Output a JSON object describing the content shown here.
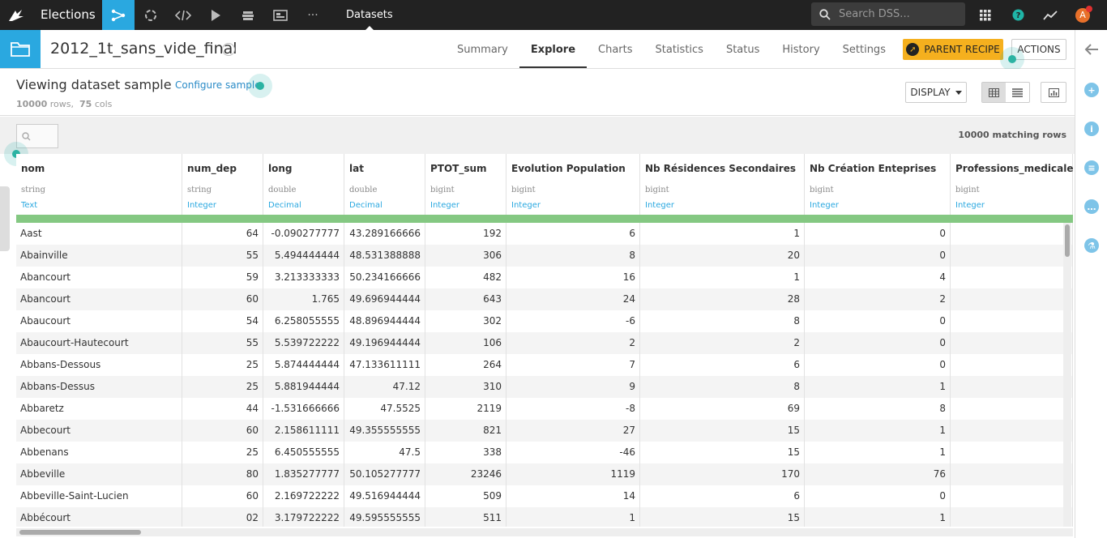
{
  "topbar": {
    "app_title": "Elections",
    "nav_datasets": "Datasets",
    "search_placeholder": "Search DSS...",
    "avatar_letter": "A"
  },
  "dataset": {
    "name": "2012_1t_sans_vide_final",
    "tabs": [
      "Summary",
      "Explore",
      "Charts",
      "Statistics",
      "Status",
      "History",
      "Settings"
    ],
    "active_tab": "Explore",
    "parent_recipe_label": "PARENT RECIPE",
    "actions_label": "ACTIONS"
  },
  "view": {
    "title": "Viewing dataset sample",
    "configure_link": "Configure sample",
    "rows_count": "10000",
    "rows_label": "rows,",
    "cols_count": "75",
    "cols_label": "cols",
    "display_label": "DISPLAY",
    "matching_rows": "10000 matching rows"
  },
  "columns": [
    {
      "name": "nom",
      "storage": "string",
      "meaning": "Text"
    },
    {
      "name": "num_dep",
      "storage": "string",
      "meaning": "Integer"
    },
    {
      "name": "long",
      "storage": "double",
      "meaning": "Decimal"
    },
    {
      "name": "lat",
      "storage": "double",
      "meaning": "Decimal"
    },
    {
      "name": "PTOT_sum",
      "storage": "bigint",
      "meaning": "Integer"
    },
    {
      "name": "Evolution Population",
      "storage": "bigint",
      "meaning": "Integer"
    },
    {
      "name": "Nb Résidences Secondaires",
      "storage": "bigint",
      "meaning": "Integer"
    },
    {
      "name": "Nb Création Enteprises",
      "storage": "bigint",
      "meaning": "Integer"
    },
    {
      "name": "Professions_medicales",
      "storage": "bigint",
      "meaning": "Integer"
    }
  ],
  "rows": [
    [
      "Aast",
      "64",
      "-0.090277777",
      "43.289166666",
      "192",
      "6",
      "1",
      "0",
      ""
    ],
    [
      "Abainville",
      "55",
      "5.494444444",
      "48.531388888",
      "306",
      "8",
      "20",
      "0",
      ""
    ],
    [
      "Abancourt",
      "59",
      "3.213333333",
      "50.234166666",
      "482",
      "16",
      "1",
      "4",
      ""
    ],
    [
      "Abancourt",
      "60",
      "1.765",
      "49.696944444",
      "643",
      "24",
      "28",
      "2",
      ""
    ],
    [
      "Abaucourt",
      "54",
      "6.258055555",
      "48.896944444",
      "302",
      "-6",
      "8",
      "0",
      ""
    ],
    [
      "Abaucourt-Hautecourt",
      "55",
      "5.539722222",
      "49.196944444",
      "106",
      "2",
      "2",
      "0",
      ""
    ],
    [
      "Abbans-Dessous",
      "25",
      "5.874444444",
      "47.133611111",
      "264",
      "7",
      "6",
      "0",
      ""
    ],
    [
      "Abbans-Dessus",
      "25",
      "5.881944444",
      "47.12",
      "310",
      "9",
      "8",
      "1",
      ""
    ],
    [
      "Abbaretz",
      "44",
      "-1.531666666",
      "47.5525",
      "2119",
      "-8",
      "69",
      "8",
      ""
    ],
    [
      "Abbecourt",
      "60",
      "2.158611111",
      "49.355555555",
      "821",
      "27",
      "15",
      "1",
      ""
    ],
    [
      "Abbenans",
      "25",
      "6.450555555",
      "47.5",
      "338",
      "-46",
      "15",
      "1",
      ""
    ],
    [
      "Abbeville",
      "80",
      "1.835277777",
      "50.105277777",
      "23246",
      "1119",
      "170",
      "76",
      ""
    ],
    [
      "Abbeville-Saint-Lucien",
      "60",
      "2.169722222",
      "49.516944444",
      "509",
      "14",
      "6",
      "0",
      ""
    ],
    [
      "Abbécourt",
      "02",
      "3.179722222",
      "49.595555555",
      "511",
      "1",
      "15",
      "1",
      ""
    ]
  ]
}
